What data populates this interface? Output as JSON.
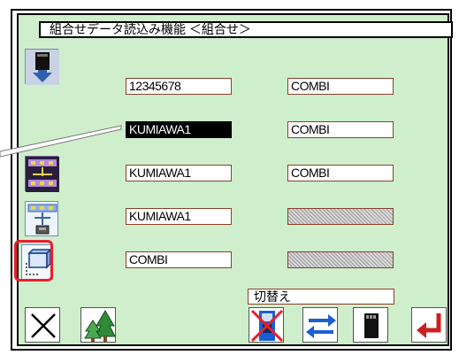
{
  "title": "組合せデータ読込み機能 ＜組合せ＞",
  "rows": [
    {
      "left": "12345678",
      "right": "COMBI",
      "left_state": "normal",
      "right_state": "normal"
    },
    {
      "left": "KUMIAWA1",
      "right": "COMBI",
      "left_state": "selected",
      "right_state": "normal"
    },
    {
      "left": "KUMIAWA1",
      "right": "COMBI",
      "left_state": "normal",
      "right_state": "normal"
    },
    {
      "left": "KUMIAWA1",
      "right": "",
      "left_state": "normal",
      "right_state": "hatched"
    },
    {
      "left": "COMBI",
      "right": "",
      "left_state": "normal",
      "right_state": "hatched"
    }
  ],
  "left_buttons": [
    {
      "icon": "file-download-icon"
    },
    {
      "icon": "combination-purple-icon"
    },
    {
      "icon": "combination-blue-icon"
    },
    {
      "icon": "folder-select-icon",
      "highlighted": true
    }
  ],
  "switch_label": "切替え",
  "bottom_buttons": [
    {
      "icon": "close-icon"
    },
    {
      "icon": "tree-icon"
    },
    {
      "icon": "disabled-card-icon"
    },
    {
      "icon": "swap-arrows-icon"
    },
    {
      "icon": "memory-card-icon"
    },
    {
      "icon": "enter-icon"
    }
  ],
  "colors": {
    "panel": "#cfeecb",
    "highlight": "#e8202a",
    "field_border": "#8a3f2b",
    "accent_blue": "#1a5fd0",
    "enter_red": "#cc1f1f"
  }
}
